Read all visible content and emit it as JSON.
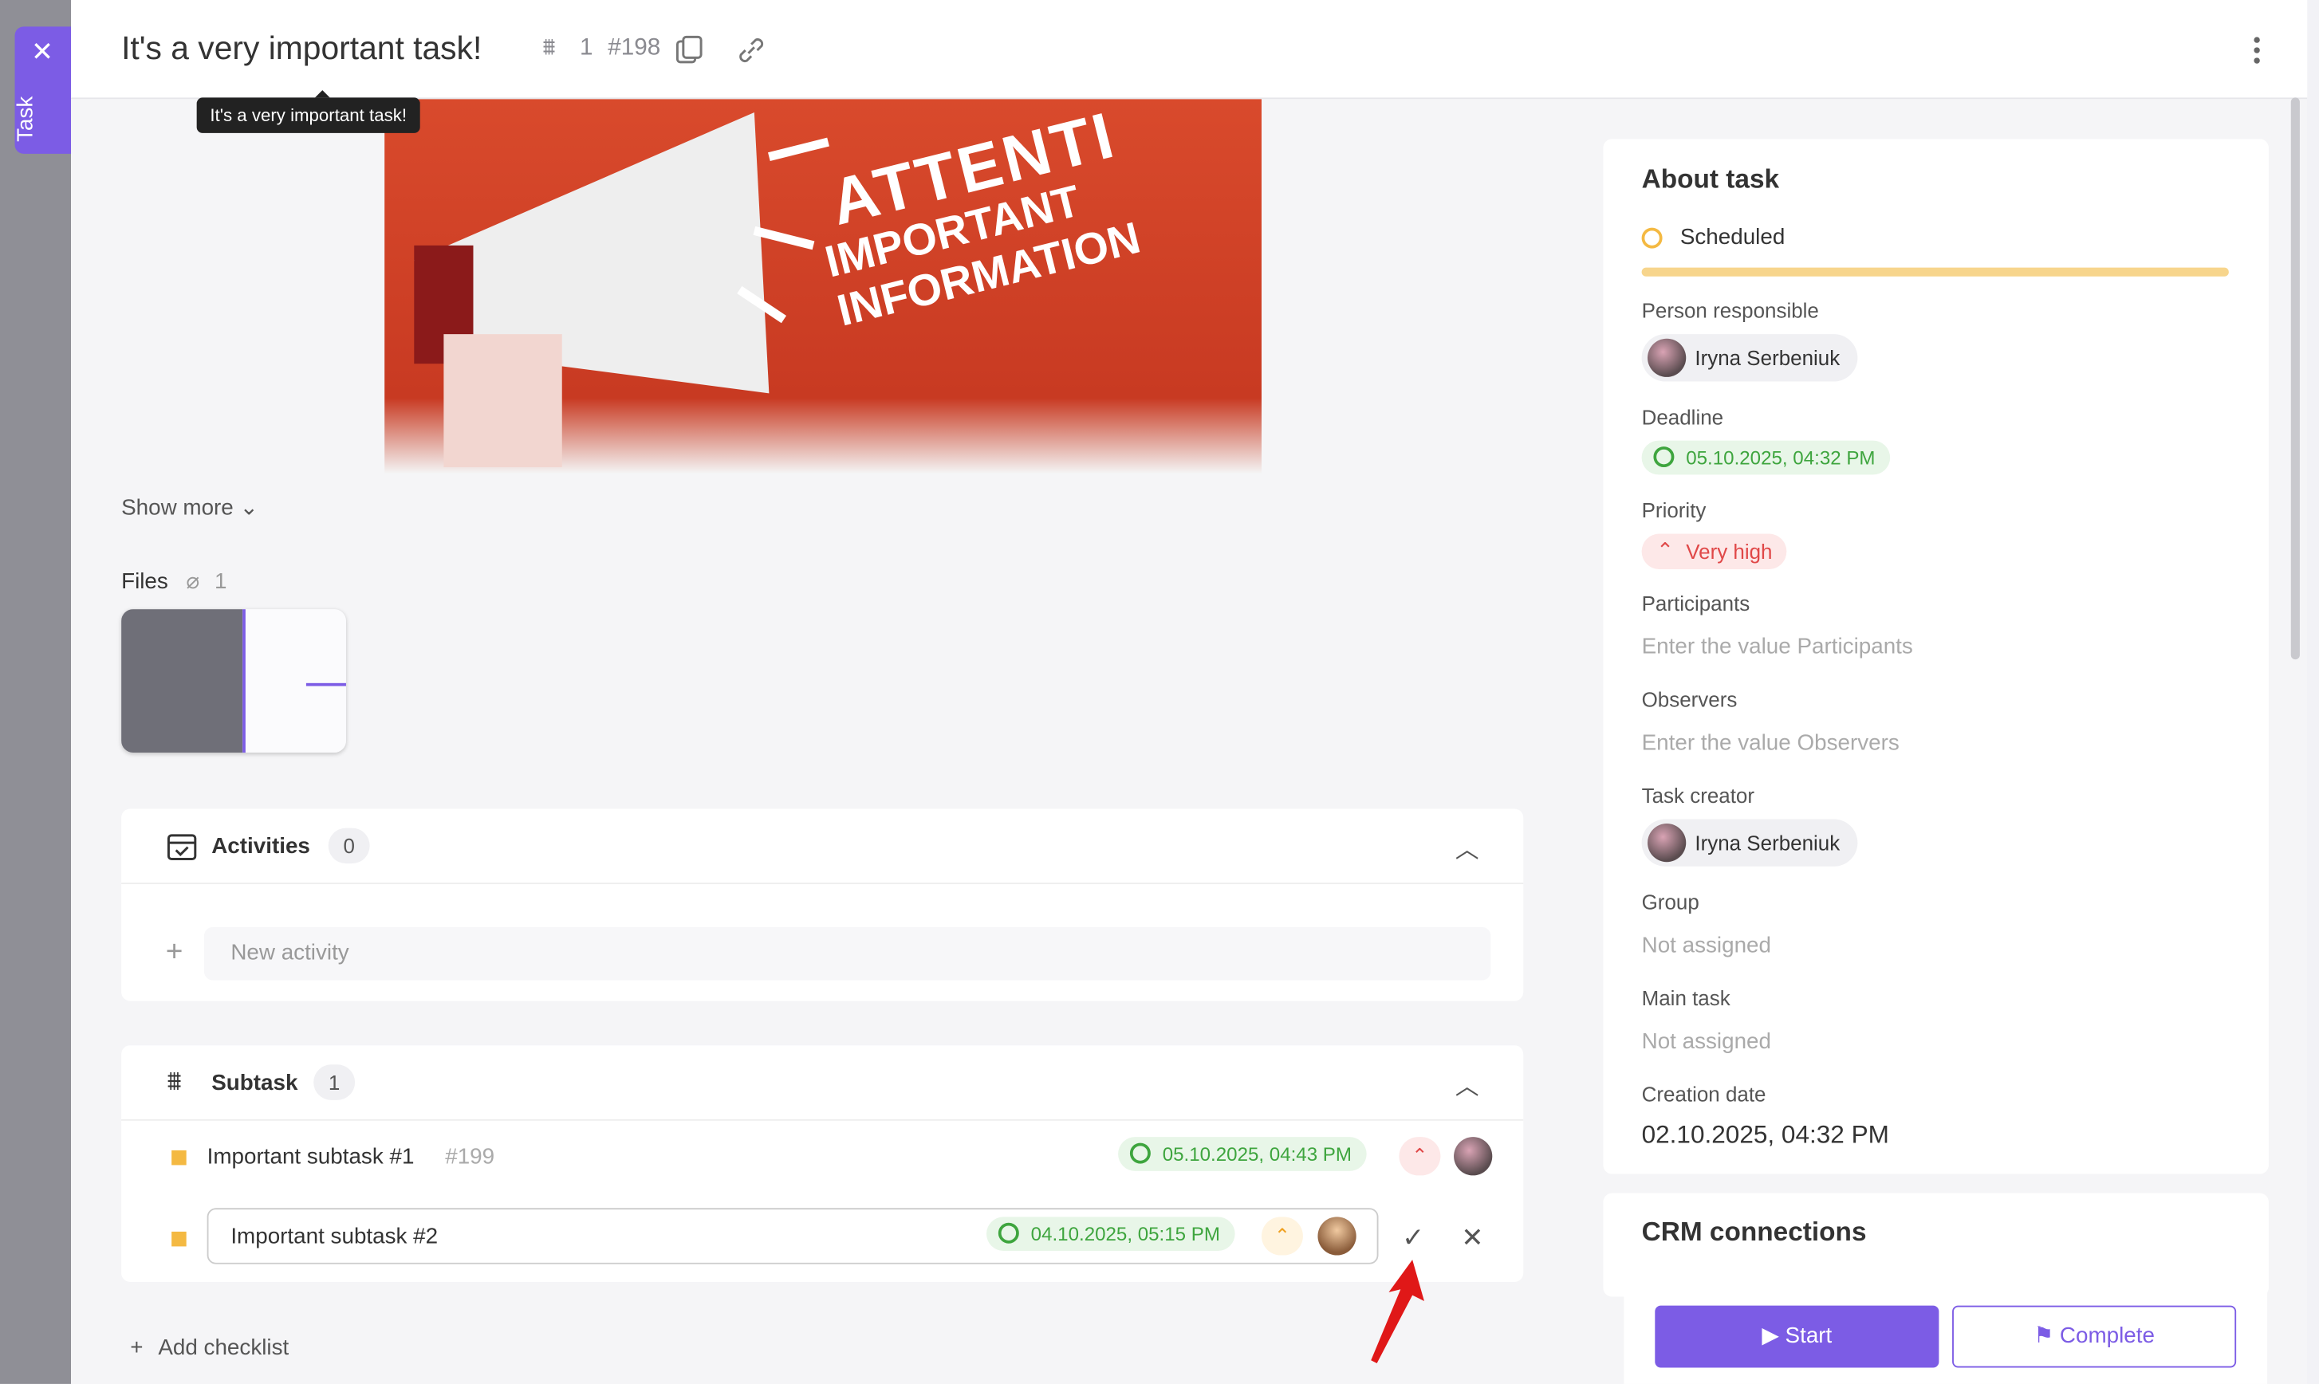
{
  "side_tab": {
    "label": "Task",
    "close_icon": "close-icon"
  },
  "header": {
    "title": "It's a very important task!",
    "subtask_count": "1",
    "task_number": "#198",
    "tooltip": "It's a very important task!"
  },
  "banner": {
    "line1": "ATTENTI",
    "line2": "IMPORTANT",
    "line3": "INFORMATION"
  },
  "content": {
    "show_more": "Show more",
    "files_label": "Files",
    "files_count": "1"
  },
  "activities": {
    "title": "Activities",
    "count": "0",
    "new_placeholder": "New activity"
  },
  "subtasks": {
    "title": "Subtask",
    "count": "1",
    "items": [
      {
        "name": "Important subtask #1",
        "number": "#199",
        "deadline": "05.10.2025, 04:43 PM"
      }
    ],
    "editing": {
      "value": "Important subtask #2",
      "deadline": "04.10.2025, 05:15 PM"
    }
  },
  "add_checklist": "Add checklist",
  "about": {
    "title": "About task",
    "status": "Scheduled",
    "person_label": "Person responsible",
    "person": "Iryna Serbeniuk",
    "deadline_label": "Deadline",
    "deadline": "05.10.2025, 04:32 PM",
    "priority_label": "Priority",
    "priority": "Very high",
    "participants_label": "Participants",
    "participants_placeholder": "Enter the value Participants",
    "observers_label": "Observers",
    "observers_placeholder": "Enter the value Observers",
    "creator_label": "Task creator",
    "creator": "Iryna Serbeniuk",
    "group_label": "Group",
    "group": "Not assigned",
    "main_task_label": "Main task",
    "main_task": "Not assigned",
    "creation_label": "Creation date",
    "creation": "02.10.2025, 04:32 PM"
  },
  "crm": {
    "title": "CRM connections"
  },
  "footer": {
    "start": "Start",
    "complete": "Complete"
  },
  "colors": {
    "accent": "#7c5ce5",
    "status": "#f4b942",
    "deadline": "#3ea53e",
    "priority": "#e04848"
  }
}
